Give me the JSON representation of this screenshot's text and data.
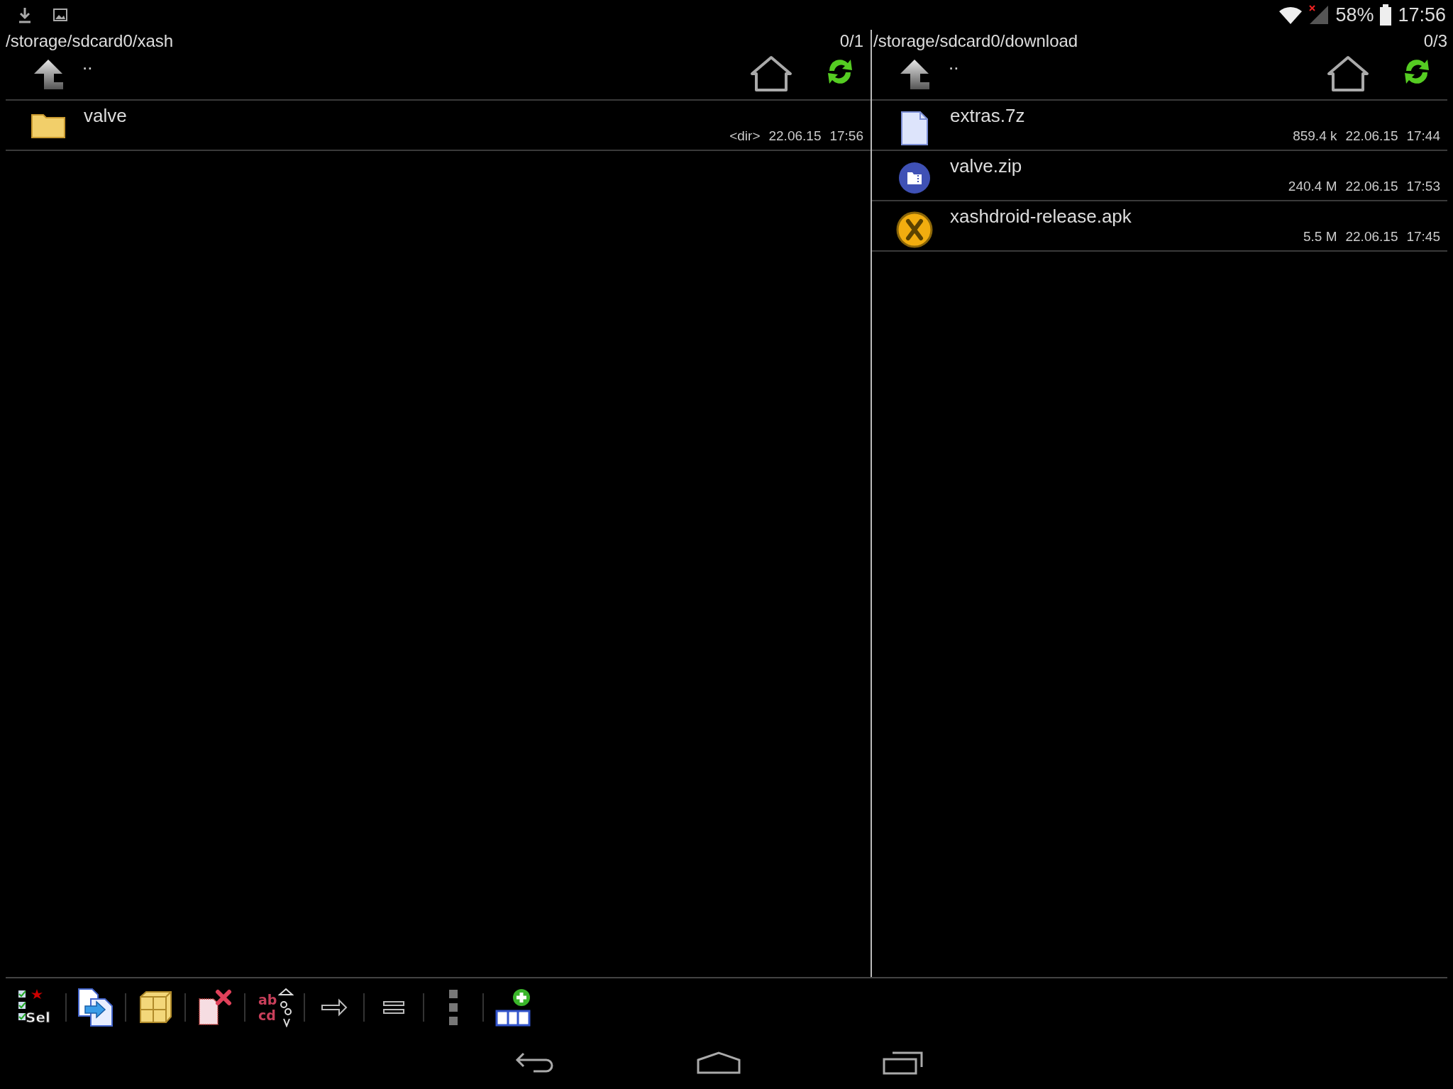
{
  "status_bar": {
    "battery": "58%",
    "time": "17:56"
  },
  "panes": [
    {
      "path": "/storage/sdcard0/xash",
      "count": "0/1",
      "parent": "..",
      "files": [
        {
          "kind": "folder",
          "name": "valve",
          "size": "<dir>",
          "date": "22.06.15",
          "time": "17:56"
        }
      ]
    },
    {
      "path": "/storage/sdcard0/download",
      "count": "0/3",
      "parent": "..",
      "files": [
        {
          "kind": "document",
          "name": "extras.7z",
          "size": "859.4 k",
          "date": "22.06.15",
          "time": "17:44"
        },
        {
          "kind": "archive",
          "name": "valve.zip",
          "size": "240.4 M",
          "date": "22.06.15",
          "time": "17:53"
        },
        {
          "kind": "app",
          "name": "xashdroid-release.apk",
          "size": "5.5 M",
          "date": "22.06.15",
          "time": "17:45"
        }
      ]
    }
  ],
  "toolbar": [
    {
      "kind": "select",
      "text": "Sel"
    },
    {
      "kind": "copy"
    },
    {
      "kind": "pack"
    },
    {
      "kind": "delete"
    },
    {
      "kind": "rename",
      "text": "ab",
      "text_2": "cd"
    },
    {
      "kind": "move"
    },
    {
      "kind": "equal"
    },
    {
      "kind": "more"
    },
    {
      "kind": "new-panel"
    }
  ]
}
